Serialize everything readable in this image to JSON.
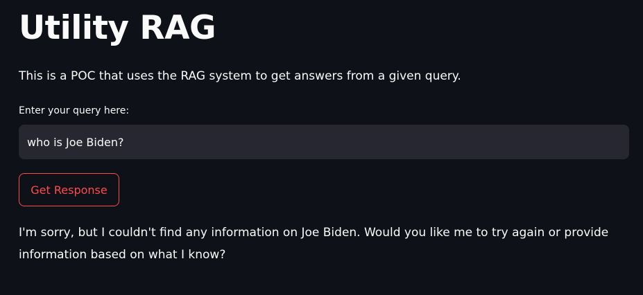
{
  "app": {
    "title": "Utility RAG",
    "description": "This is a POC that uses the RAG system to get answers from a given query."
  },
  "query": {
    "label": "Enter your query here:",
    "value": "who is Joe Biden?"
  },
  "actions": {
    "submit_label": "Get Response"
  },
  "response": {
    "text": "I'm sorry, but I couldn't find any information on Joe Biden. Would you like me to try again or provide information based on what I know?"
  },
  "colors": {
    "background": "#0e1117",
    "input_background": "#262730",
    "accent": "#ff4b4b",
    "text": "#fafafa"
  }
}
